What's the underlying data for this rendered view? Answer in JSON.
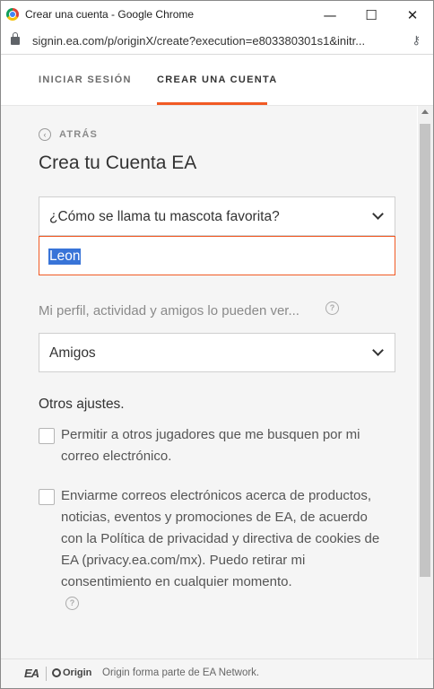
{
  "window": {
    "title": "Crear una cuenta - Google Chrome",
    "minimize": "—",
    "maximize": "☐",
    "close": "✕"
  },
  "address": {
    "url": "signin.ea.com/p/originX/create?execution=e803380301s1&initr..."
  },
  "tabs": {
    "sign_in": "INICIAR SESIÓN",
    "create": "CREAR UNA CUENTA"
  },
  "form": {
    "back_label": "ATRÁS",
    "heading": "Crea tu Cuenta EA",
    "security_question": "¿Cómo se llama tu mascota favorita?",
    "security_answer": "Leon",
    "visibility_help": "Mi perfil, actividad y amigos lo pueden ver...",
    "visibility_value": "Amigos",
    "other_settings": "Otros ajustes.",
    "checkbox1": "Permitir a otros jugadores que me busquen por mi correo electrónico.",
    "checkbox2": "Enviarme correos electrónicos acerca de productos, noticias, eventos y promociones de EA, de acuerdo con la Política de privacidad y directiva de cookies de EA (privacy.ea.com/mx). Puedo retirar mi consentimiento en cualquier momento."
  },
  "footer": {
    "ea_logo": "EA",
    "origin_logo": "Origin",
    "text": "Origin forma parte de EA Network."
  },
  "colors": {
    "accent": "#f15a24",
    "selection": "#3874d8"
  }
}
